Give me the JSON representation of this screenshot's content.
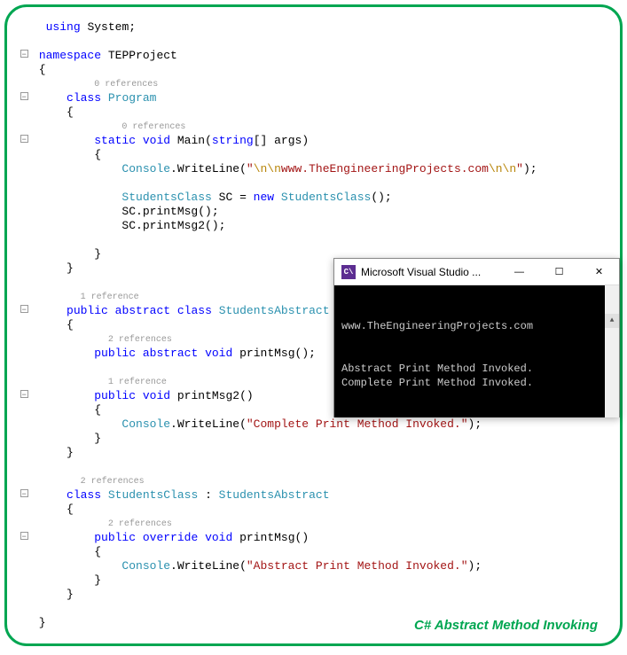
{
  "code": {
    "kw_using": "using",
    "system": "System",
    "kw_namespace": "namespace",
    "ns_name": "TEPProject",
    "ref0": "0 references",
    "ref1": "1 reference",
    "ref2": "2 references",
    "kw_class": "class",
    "program": "Program",
    "kw_static": "static",
    "kw_void": "void",
    "main": "Main",
    "kw_string": "string",
    "args": "args",
    "console": "Console",
    "writeln": "WriteLine",
    "esc_n": "\\n\\n",
    "url_str": "www.TheEngineeringProjects.com",
    "students_class": "StudentsClass",
    "sc_var": "SC",
    "kw_new": "new",
    "printmsg": "printMsg",
    "printmsg2": "printMsg2",
    "kw_public": "public",
    "kw_abstract": "abstract",
    "students_abstract": "StudentsAbstract",
    "complete_str": "\"Complete Print Method Invoked.\"",
    "kw_override": "override",
    "abstract_str": "\"Abstract Print Method Invoked.\""
  },
  "console": {
    "title": "Microsoft Visual Studio ...",
    "line1": "www.TheEngineeringProjects.com",
    "line2": "Abstract Print Method Invoked.",
    "line3": "Complete Print Method Invoked."
  },
  "caption": "C# Abstract Method Invoking"
}
